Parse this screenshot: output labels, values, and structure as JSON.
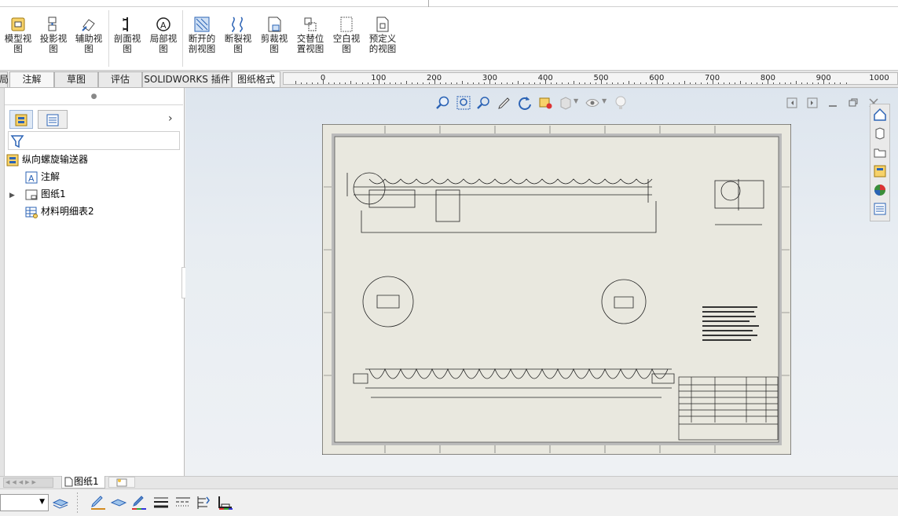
{
  "ribbon": {
    "buttons": [
      {
        "name": "model-view-button",
        "label": "模型视\n图",
        "icon": "model-view-icon"
      },
      {
        "name": "projected-view-button",
        "label": "投影视\n图",
        "icon": "projected-view-icon"
      },
      {
        "name": "auxiliary-view-button",
        "label": "辅助视\n图",
        "icon": "auxiliary-view-icon"
      },
      {
        "name": "section-view-button",
        "label": "剖面视\n图",
        "icon": "section-view-icon"
      },
      {
        "name": "detail-view-button",
        "label": "局部视\n图",
        "icon": "detail-view-icon"
      },
      {
        "name": "broken-out-section-button",
        "label": "断开的\n剖视图",
        "icon": "broken-out-section-icon"
      },
      {
        "name": "break-view-button",
        "label": "断裂视\n图",
        "icon": "break-icon"
      },
      {
        "name": "crop-view-button",
        "label": "剪裁视\n图",
        "icon": "crop-icon"
      },
      {
        "name": "alternate-position-view-button",
        "label": "交替位\n置视图",
        "icon": "alternate-position-icon"
      },
      {
        "name": "empty-view-button",
        "label": "空白视\n图",
        "icon": "empty-view-icon"
      },
      {
        "name": "predefined-view-button",
        "label": "预定义\n的视图",
        "icon": "predefined-view-icon"
      }
    ]
  },
  "tabs": {
    "partial": "局",
    "items": [
      {
        "name": "tab-annotation",
        "label": "注解"
      },
      {
        "name": "tab-sketch",
        "label": "草图"
      },
      {
        "name": "tab-evaluate",
        "label": "评估"
      },
      {
        "name": "tab-solidworks-addins",
        "label": "SOLIDWORKS 插件"
      },
      {
        "name": "tab-sheet-format",
        "label": "图纸格式"
      }
    ]
  },
  "ruler": {
    "labels": [
      "0",
      "100",
      "200",
      "300",
      "400",
      "500",
      "600",
      "700",
      "800",
      "900",
      "1000"
    ]
  },
  "feature_tree": {
    "root": "纵向螺旋输送器",
    "items": [
      {
        "name": "tree-item-annotations",
        "label": "注解",
        "icon": "annotations-icon"
      },
      {
        "name": "tree-item-sheet1",
        "label": "图纸1",
        "icon": "sheet-icon"
      },
      {
        "name": "tree-item-bom",
        "label": "材料明细表2",
        "icon": "bom-table-icon"
      }
    ]
  },
  "sheet_tabs": {
    "active": "图纸1"
  },
  "colors": {
    "accent": "#2b63b5",
    "paper": "#e9e8df",
    "canvas_bg": "#e3e9ef"
  }
}
